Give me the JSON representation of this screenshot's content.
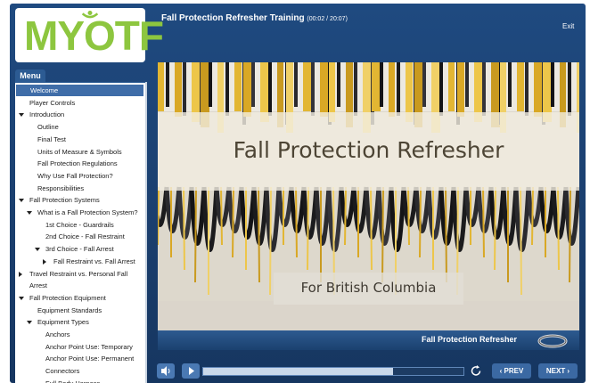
{
  "app": {
    "logo": "MYOTF",
    "course_title": "Fall Protection Refresher Training",
    "time": "(00:02 / 20:07)",
    "exit_label": "Exit"
  },
  "menu": {
    "tab_label": "Menu",
    "items": [
      {
        "label": "Welcome",
        "indent": 0,
        "arrow": "none",
        "selected": true
      },
      {
        "label": "Player Controls",
        "indent": 0,
        "arrow": "none"
      },
      {
        "label": "Introduction",
        "indent": 0,
        "arrow": "down"
      },
      {
        "label": "Outline",
        "indent": 1,
        "arrow": "none"
      },
      {
        "label": "Final Test",
        "indent": 1,
        "arrow": "none"
      },
      {
        "label": "Units of Measure & Symbols",
        "indent": 1,
        "arrow": "none"
      },
      {
        "label": "Fall Protection Regulations",
        "indent": 1,
        "arrow": "none"
      },
      {
        "label": "Why Use Fall Protection?",
        "indent": 1,
        "arrow": "none"
      },
      {
        "label": "Responsibilities",
        "indent": 1,
        "arrow": "none"
      },
      {
        "label": "Fall Protection Systems",
        "indent": 0,
        "arrow": "down"
      },
      {
        "label": "What is a Fall Protection System?",
        "indent": 1,
        "arrow": "down"
      },
      {
        "label": "1st Choice - Guardrails",
        "indent": 2,
        "arrow": "none"
      },
      {
        "label": "2nd Choice - Fall Restraint",
        "indent": 2,
        "arrow": "none"
      },
      {
        "label": "3rd Choice - Fall Arrest",
        "indent": 2,
        "arrow": "down"
      },
      {
        "label": "Fall Restraint vs. Fall Arrest",
        "indent": 3,
        "arrow": "right"
      },
      {
        "label": "Travel Restraint vs. Personal Fall",
        "indent": 0,
        "arrow": "right"
      },
      {
        "label": "Arrest",
        "indent": 0,
        "arrow": "none",
        "continuation": true
      },
      {
        "label": "Fall Protection Equipment",
        "indent": 0,
        "arrow": "down"
      },
      {
        "label": "Equipment Standards",
        "indent": 1,
        "arrow": "none"
      },
      {
        "label": "Equipment Types",
        "indent": 1,
        "arrow": "down"
      },
      {
        "label": "Anchors",
        "indent": 2,
        "arrow": "none"
      },
      {
        "label": "Anchor Point Use: Temporary",
        "indent": 2,
        "arrow": "none"
      },
      {
        "label": "Anchor Point Use: Permanent",
        "indent": 2,
        "arrow": "none"
      },
      {
        "label": "Connectors",
        "indent": 2,
        "arrow": "none"
      },
      {
        "label": "Full Body Harness",
        "indent": 2,
        "arrow": "none"
      }
    ]
  },
  "slide": {
    "title": "Fall Protection Refresher",
    "subtitle": "For British Columbia",
    "caption": "Fall Protection Refresher"
  },
  "controls": {
    "prev_label": "‹ PREV",
    "next_label": "NEXT ›",
    "progress_fraction": 0.73
  },
  "colors": {
    "frame": "#1a3e6d",
    "logo_green": "#8dc63f",
    "selected": "#3f6da8"
  }
}
